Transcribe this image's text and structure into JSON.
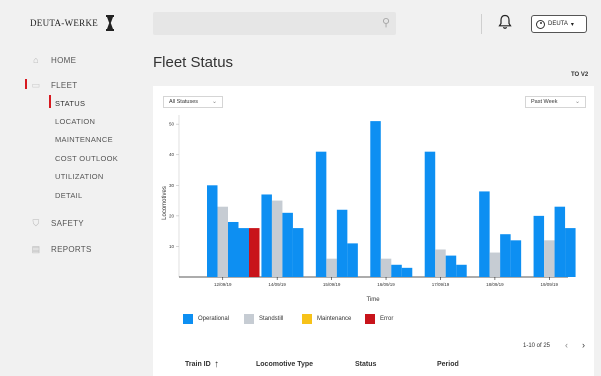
{
  "brand": {
    "logo_text": "DEUTA-WERKE"
  },
  "sidebar": {
    "items": [
      {
        "label": "HOME",
        "icon": "home-icon"
      },
      {
        "label": "FLEET",
        "icon": "train-icon"
      },
      {
        "label": "SAFETY",
        "icon": "shield-icon"
      },
      {
        "label": "REPORTS",
        "icon": "document-icon"
      }
    ],
    "fleet_subitems": [
      {
        "label": "STATUS",
        "active": true
      },
      {
        "label": "LOCATION"
      },
      {
        "label": "MAINTENANCE"
      },
      {
        "label": "COST OUTLOOK"
      },
      {
        "label": "UTILIZATION"
      },
      {
        "label": "DETAIL"
      }
    ]
  },
  "topbar": {
    "search_placeholder": "",
    "user_label": "DEUTA"
  },
  "page": {
    "title": "Fleet Status",
    "version": "TO V2"
  },
  "filters": {
    "status": "All Statuses",
    "period": "Past Week"
  },
  "colors": {
    "operational": "#0d8ff2",
    "standstill": "#c6ccd3",
    "maintenance": "#f7c219",
    "error": "#c8141b",
    "accent": "#d71920"
  },
  "chart_data": {
    "type": "bar",
    "categories": [
      "12/09/19",
      "14/09/19",
      "15/09/19",
      "16/09/19",
      "17/09/19",
      "18/09/19",
      "19/09/19"
    ],
    "series": [
      {
        "name": "Operational",
        "values": [
          30,
          27,
          41,
          51,
          41,
          28,
          20
        ]
      },
      {
        "name": "Standstill",
        "values": [
          23,
          25,
          6,
          6,
          9,
          8,
          12
        ]
      },
      {
        "name": "Operational",
        "values": [
          18,
          21,
          22,
          4,
          7,
          14,
          23
        ]
      },
      {
        "name": "Operational",
        "values": [
          16,
          16,
          11,
          3,
          4,
          12,
          16
        ]
      },
      {
        "name": "Error",
        "values": [
          16,
          0,
          0,
          0,
          0,
          0,
          0
        ]
      }
    ],
    "xlabel": "Time",
    "ylabel": "Locomotives",
    "yticks": [
      10,
      20,
      30,
      40,
      50
    ],
    "ylim": [
      0,
      53
    ],
    "legend": [
      "Operational",
      "Standstill",
      "Maintenance",
      "Error"
    ],
    "legend_position": "bottom-left"
  },
  "table": {
    "pagination": "1-10 of 25",
    "columns": [
      "Train ID",
      "Locomotive Type",
      "Status",
      "Period"
    ]
  }
}
